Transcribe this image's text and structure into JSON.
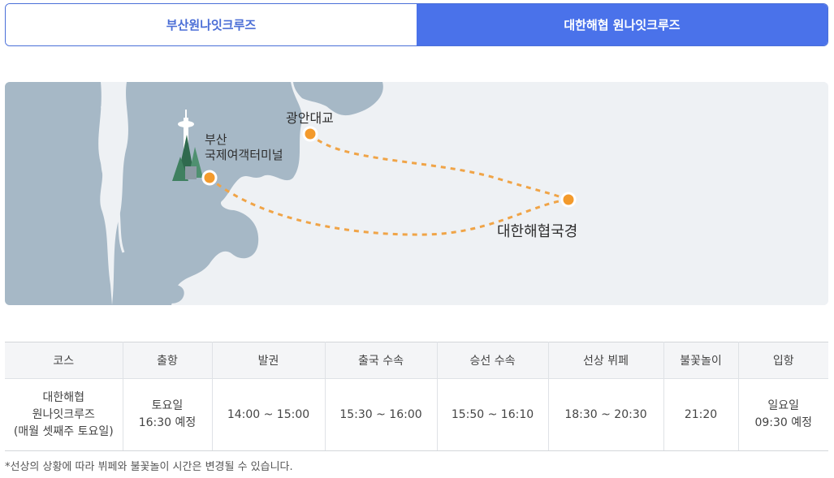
{
  "tabs": [
    {
      "label": "부산원나잇크루즈",
      "active": false
    },
    {
      "label": "대한해협 원나잇크루즈",
      "active": true
    }
  ],
  "map": {
    "labels": {
      "bridge": "광안대교",
      "terminal_line1": "부산",
      "terminal_line2": "국제여객터미널",
      "border": "대한해협국경"
    },
    "colors": {
      "land": "#a6b8c6",
      "sea": "#eef1f4",
      "route": "#f0a447",
      "dot": "#f39a2c"
    }
  },
  "table": {
    "headers": [
      "코스",
      "출항",
      "발권",
      "출국 수속",
      "승선 수속",
      "선상 뷔페",
      "불꽃놀이",
      "입항"
    ],
    "row": {
      "course": [
        "대한해협",
        "원나잇크루즈",
        "(매월 셋째주 토요일)"
      ],
      "departure": [
        "토요일",
        "16:30 예정"
      ],
      "ticketing": "14:00 ~ 15:00",
      "departure_procedure": "15:30 ~ 16:00",
      "boarding_procedure": "15:50 ~ 16:10",
      "buffet": "18:30 ~ 20:30",
      "fireworks": "21:20",
      "arrival": [
        "일요일",
        "09:30 예정"
      ]
    }
  },
  "note": "*선상의 상황에 따라 뷔페와 불꽃놀이 시간은 변경될 수 있습니다."
}
